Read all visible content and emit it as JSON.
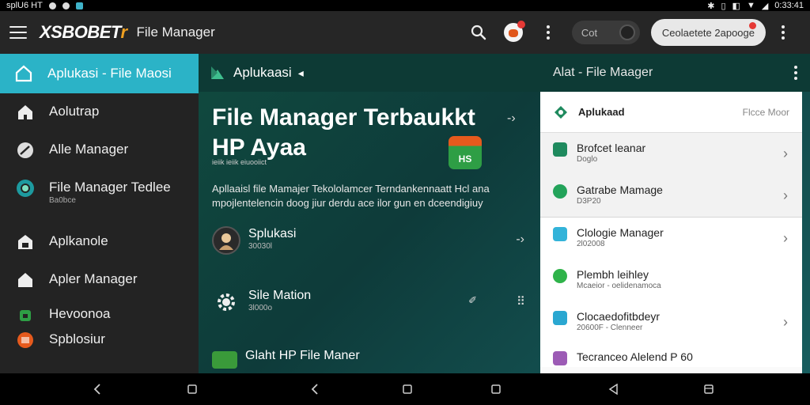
{
  "status_bar": {
    "left_text": "splU6 HT",
    "time": "0:33:41"
  },
  "app_bar": {
    "brand_main": "XSBOBET",
    "brand_suffix": "r",
    "title": "File Manager",
    "toggle_label": "Cot",
    "action_label": "Ceolaetete 2apooge"
  },
  "sidebar": {
    "header": "Aplukasi - File Maosi",
    "items": [
      {
        "label": "Aolutrap",
        "sub": ""
      },
      {
        "label": "Alle Manager",
        "sub": ""
      },
      {
        "label": "File Manager Tedlee",
        "sub": "Ba0bce"
      },
      {
        "label": "Aplkanole",
        "sub": ""
      },
      {
        "label": "Apler Manager",
        "sub": ""
      },
      {
        "label": "Hevoonoa",
        "sub": ""
      },
      {
        "label": "Spblosiur",
        "sub": ""
      }
    ]
  },
  "main": {
    "header_title": "Aplukaasi",
    "header_right": "Alat - File Maager",
    "hero": {
      "title_line1": "File Manager Terbaukkt",
      "title_line2": "HP Ayaa",
      "subtitle": "ieiik  ieiik  eiuooiict",
      "badge": "HS",
      "desc": "Apllaaisl file Mamajer Tekololamcer Terndankennaatt Hcl ana mpojlentelencin doog jiur derdu ace ilor gun en dceendigiuy"
    },
    "feed": [
      {
        "title": "Splukasi",
        "sub": "30030l"
      },
      {
        "title": "Sile Mation",
        "sub": "3l000o"
      },
      {
        "title": "Glaht HP File Maner",
        "sub": ""
      }
    ]
  },
  "panel": {
    "header_title": "Aplukaad",
    "header_sub": "Flcce Moor",
    "rows": [
      {
        "title": "Brofcet leanar",
        "sub": "Doglo",
        "color": "#1f8a5e",
        "group": 1
      },
      {
        "title": "Gatrabe Mamage",
        "sub": "D3P20",
        "color": "#23a35a",
        "group": 1
      },
      {
        "title": "Clologie Manager",
        "sub": "2l02008",
        "color": "#33b3d9",
        "group": 2
      },
      {
        "title": "Plembh leihley",
        "sub": "Mcaeior - oelidenamoca",
        "color": "#2fb34a",
        "group": 2
      },
      {
        "title": "Clocaedofitbdeyr",
        "sub": "20600F - Clenneer",
        "color": "#2aa7d1",
        "group": 2
      },
      {
        "title": "Tecranceo Alelend P 60",
        "sub": "",
        "color": "#9c5bb5",
        "group": 2
      }
    ]
  },
  "colors": {
    "accent": "#2bb3c7",
    "brand_orange": "#f0a020",
    "notif_red": "#e53935"
  }
}
